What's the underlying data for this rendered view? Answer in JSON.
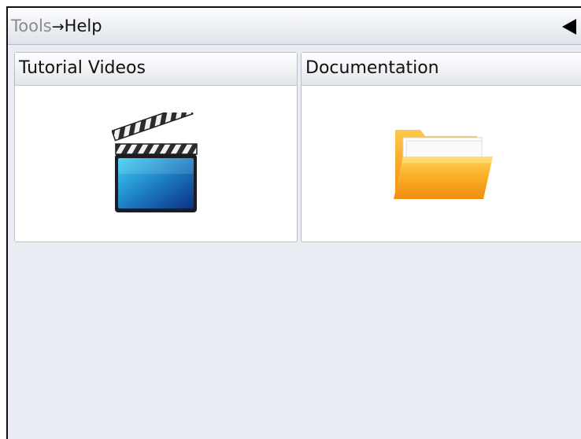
{
  "header": {
    "breadcrumb_parent": "Tools",
    "breadcrumb_separator": "→",
    "breadcrumb_current": "Help",
    "back_icon": "back-triangle-icon"
  },
  "tiles": [
    {
      "label": "Tutorial Videos",
      "icon": "clapperboard-icon"
    },
    {
      "label": "Documentation",
      "icon": "folder-icon"
    }
  ],
  "colors": {
    "background": "#e9edf3",
    "folder": "#f7a21b",
    "clapper_screen": "#1e7fc4"
  }
}
